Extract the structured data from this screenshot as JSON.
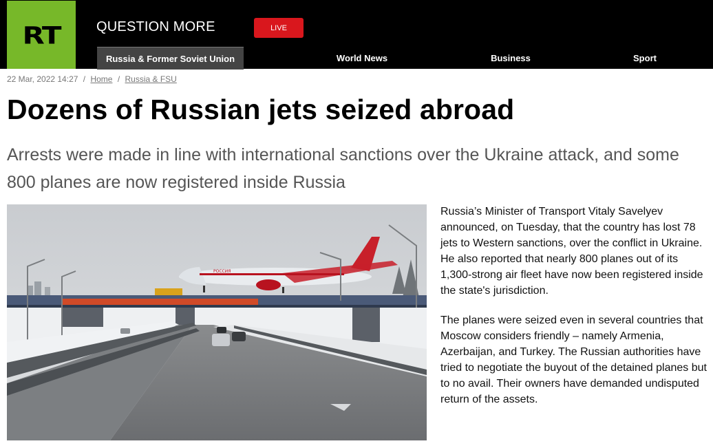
{
  "header": {
    "logo_text": "RT",
    "slogan": "QUESTION MORE",
    "live_label": "LIVE",
    "nav": [
      {
        "label": "Russia & Former Soviet Union",
        "active": true
      },
      {
        "label": "World News",
        "active": false
      },
      {
        "label": "Business",
        "active": false
      },
      {
        "label": "Sport",
        "active": false
      }
    ],
    "colors": {
      "logo_bg": "#77b829",
      "live_bg": "#d9171d",
      "active_nav_bg": "#444444"
    }
  },
  "article": {
    "date": "22 Mar, 2022 14:27",
    "breadcrumbs": [
      "Home",
      "Russia & FSU"
    ],
    "title": "Dozens of Russian jets seized abroad",
    "summary": "Arrests were made in line with international sanctions over the Ukraine attack, and some 800 planes are now registered inside Russia",
    "image_alt": "Rossiya passenger jet crossing a highway bridge in winter",
    "aircraft_livery_text": "РОССИЯ",
    "paragraphs": [
      "Russia’s Minister of Transport Vitaly Savelyev announced, on Tuesday, that the country has lost 78 jets to Western sanctions, over the conflict in Ukraine. He also reported that nearly 800 planes out of its 1,300-strong air fleet have now been registered inside the state's jurisdiction.",
      "The planes were seized even in several countries that Moscow considers friendly – namely Armenia, Azerbaijan, and Turkey. The Russian authorities have tried to negotiate the buyout of the detained planes but to no avail. Their owners have demanded undisputed return of the assets."
    ]
  }
}
